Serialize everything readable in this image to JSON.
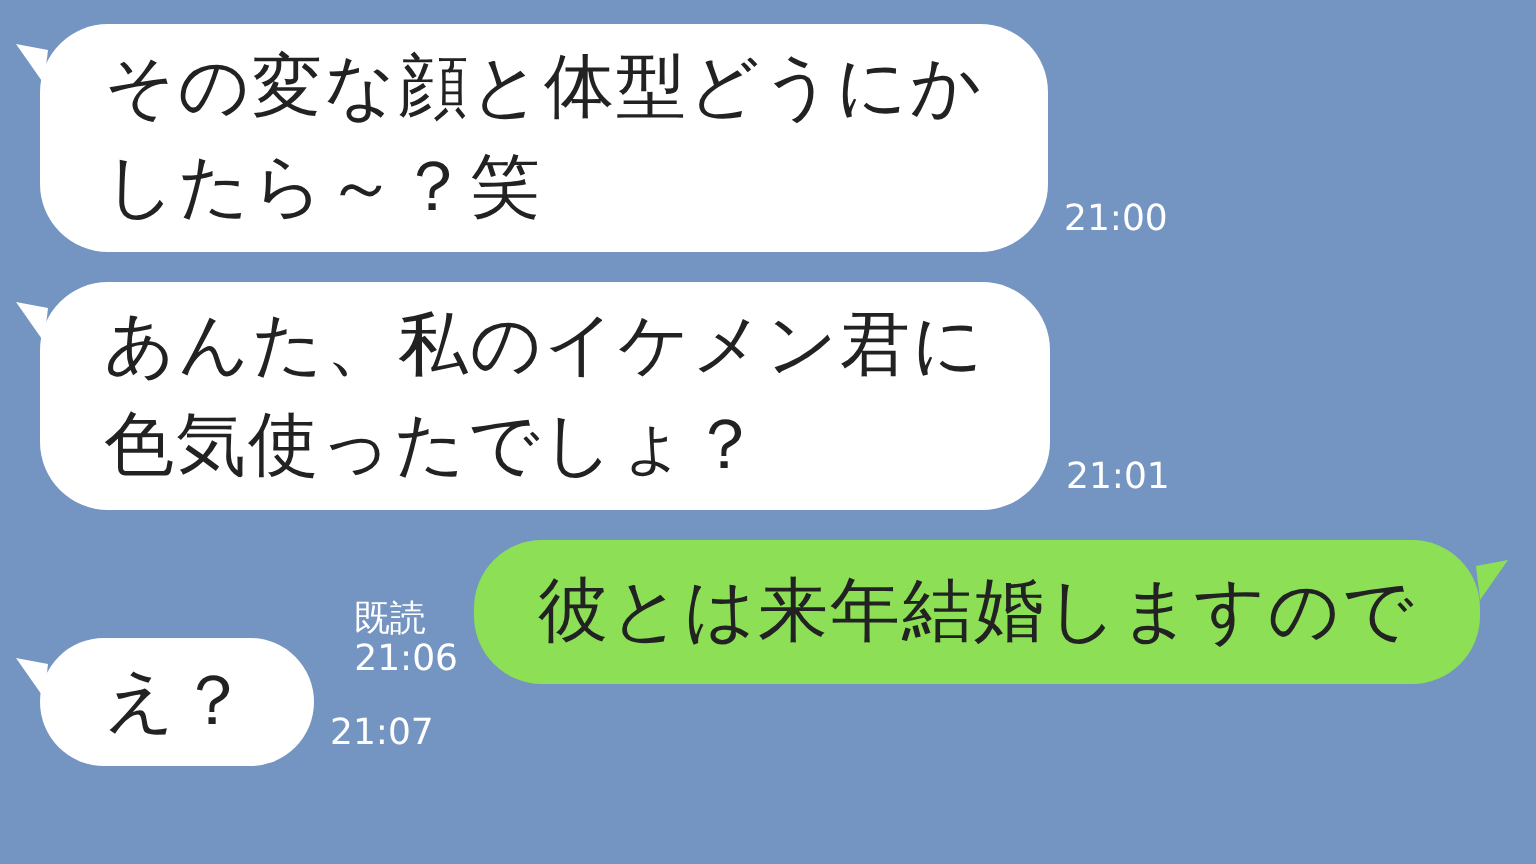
{
  "messages": [
    {
      "kind": "received",
      "lines": [
        "その変な顔と体型どうにか",
        "したら～？笑"
      ],
      "time": "21:00"
    },
    {
      "kind": "received",
      "lines": [
        "あんた、私のイケメン君に",
        "色気使ったでしょ？"
      ],
      "time": "21:01"
    },
    {
      "kind": "sent",
      "lines": [
        "彼とは来年結婚しますので"
      ],
      "read": "既読",
      "time": "21:06"
    },
    {
      "kind": "received",
      "lines": [
        "え？"
      ],
      "time": "21:07"
    }
  ]
}
